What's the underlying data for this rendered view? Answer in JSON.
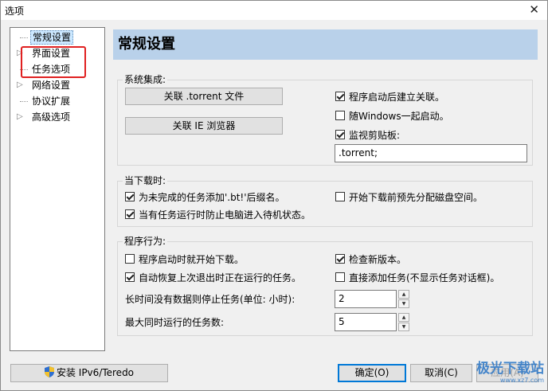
{
  "window": {
    "title": "选项",
    "close_glyph": "✕"
  },
  "tree": [
    {
      "label": "常规设置",
      "icon": "",
      "selected": true
    },
    {
      "label": "界面设置",
      "icon": "▷"
    },
    {
      "label": "任务选项",
      "icon": ""
    },
    {
      "label": "网络设置",
      "icon": "▷"
    },
    {
      "label": "协议扩展",
      "icon": ""
    },
    {
      "label": "高级选项",
      "icon": "▷"
    }
  ],
  "panel": {
    "title": "常规设置"
  },
  "system": {
    "label": "系统集成:",
    "btn_torrent": "关联 .torrent 文件",
    "btn_ie": "关联 IE 浏览器",
    "chk_assoc": "程序启动后建立关联。",
    "chk_windows": "随Windows一起启动。",
    "chk_clipboard": "监视剪贴板:",
    "clip_value": ".torrent;"
  },
  "download": {
    "label": "当下载时:",
    "chk_bt": "为未完成的任务添加'.bt!'后缀名。",
    "chk_prealloc": "开始下载前预先分配磁盘空间。",
    "chk_standby": "当有任务运行时防止电脑进入待机状态。"
  },
  "behavior": {
    "label": "程序行为:",
    "chk_autostart": "程序启动时就开始下载。",
    "chk_update": "检查新版本。",
    "chk_resume": "自动恢复上次退出时正在运行的任务。",
    "chk_direct": "直接添加任务(不显示任务对话框)。",
    "idle_label": "长时间没有数据则停止任务(单位: 小时):",
    "idle_value": "2",
    "max_label": "最大同时运行的任务数:",
    "max_value": "5"
  },
  "buttons": {
    "ipv6": "安装 IPv6/Teredo",
    "ok": "确定(O)",
    "cancel": "取消(C)",
    "apply": "应用(A)"
  },
  "watermark": {
    "text": "极光下载站",
    "sub": "www.xz7.com"
  },
  "colors": {
    "panel_header": "#b9d1ea",
    "highlight_box": "#e02020",
    "selection": "#cce8ff"
  }
}
